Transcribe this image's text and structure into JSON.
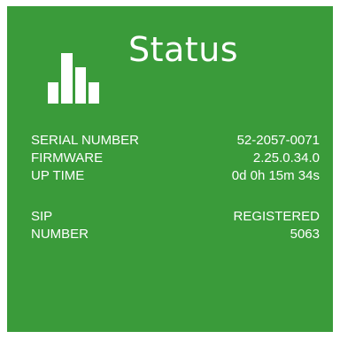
{
  "tile": {
    "background": "#3a9b3a",
    "icon": "bar-chart-icon",
    "title": "Status"
  },
  "device": [
    {
      "label": "SERIAL NUMBER",
      "value": "52-2057-0071"
    },
    {
      "label": "FIRMWARE",
      "value": "2.25.0.34.0"
    },
    {
      "label": "UP TIME",
      "value": "0d 0h 15m 34s"
    }
  ],
  "sip": [
    {
      "label": "SIP",
      "value": "REGISTERED"
    },
    {
      "label": "NUMBER",
      "value": "5063"
    }
  ]
}
